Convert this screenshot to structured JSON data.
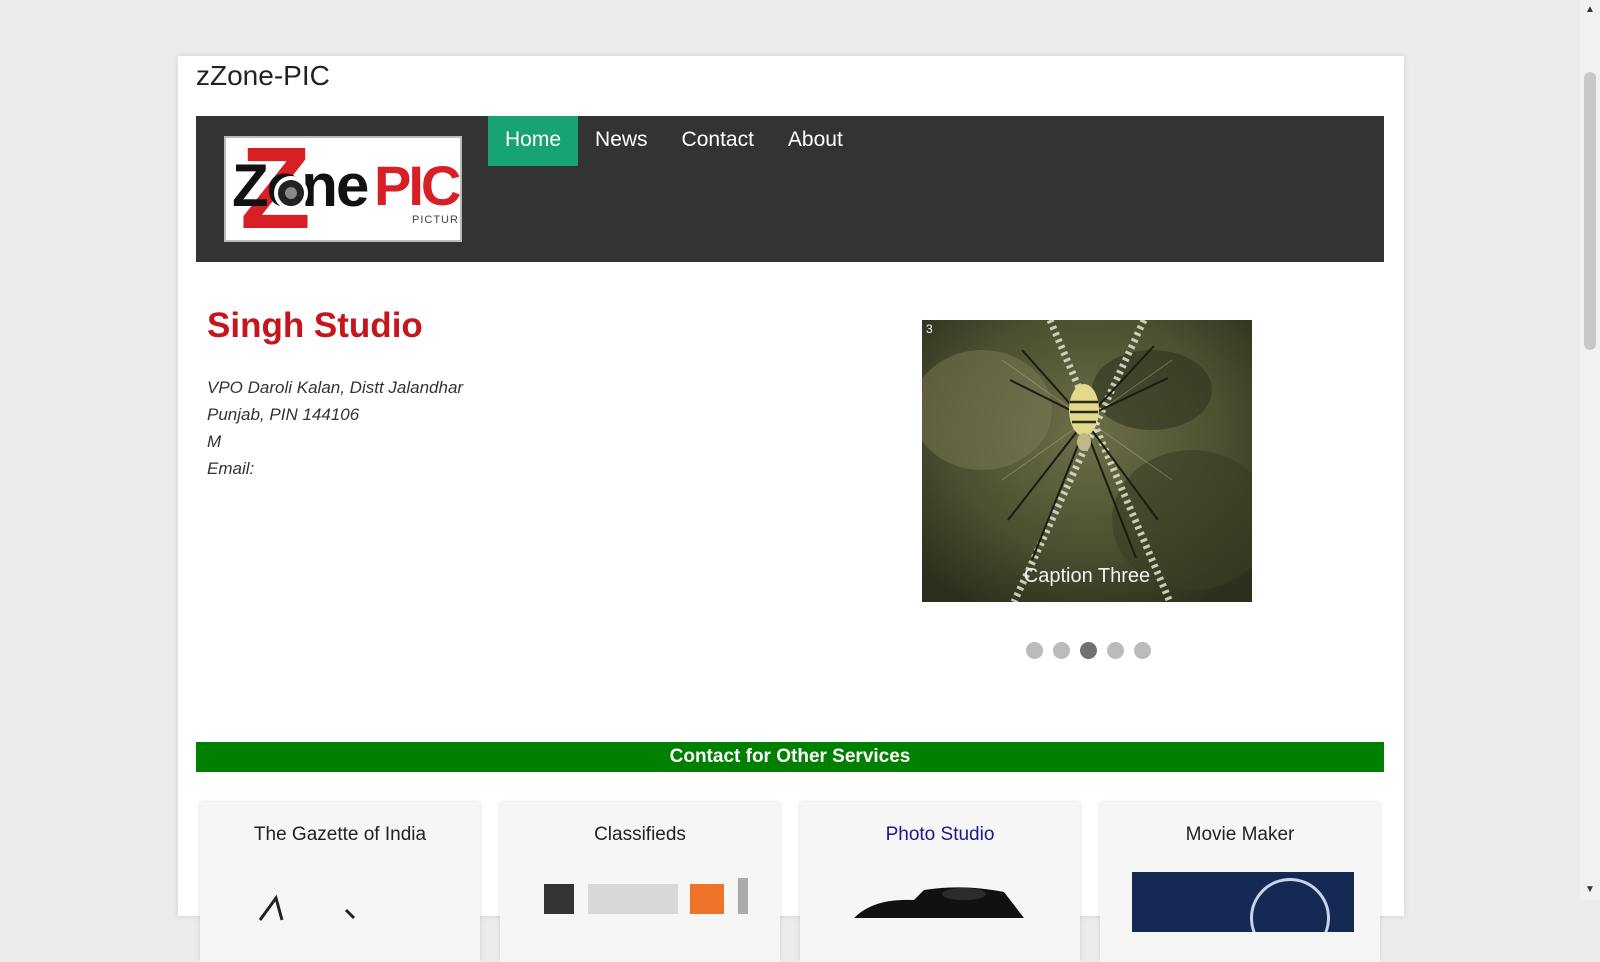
{
  "site": {
    "title": "zZone-PIC"
  },
  "logo": {
    "z": "Z",
    "zone": "one",
    "pic": "PIC.",
    "picture": "PICTURE"
  },
  "nav": {
    "items": [
      "Home",
      "News",
      "Contact",
      "About"
    ],
    "active": "Home"
  },
  "studio": {
    "name": "Singh Studio",
    "address_line1": "VPO Daroli Kalan, Distt Jalandhar",
    "address_line2": "Punjab, PIN 144106",
    "phone": "M",
    "email_label": "Email:"
  },
  "slider": {
    "slide_number": "3",
    "caption": "Caption Three",
    "dot_count": 5,
    "active_index": 3
  },
  "services": {
    "heading": "Contact for Other Services",
    "cards": [
      "The Gazette of India",
      "Classifieds",
      "Photo Studio",
      "Movie Maker"
    ]
  },
  "colors": {
    "header_bg": "#333333",
    "nav_active": "#17a374",
    "brand_red": "#c4161c",
    "services_bar": "#008000"
  },
  "icons": {
    "scroll_up": "arrow-up-icon",
    "scroll_down": "arrow-down-icon"
  }
}
